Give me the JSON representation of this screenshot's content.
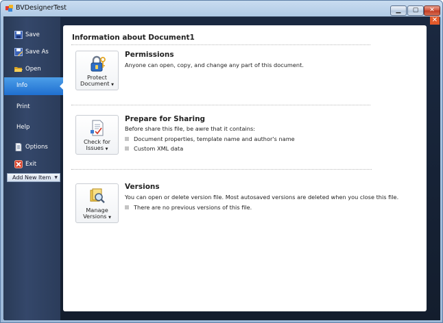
{
  "window": {
    "title": "BVDesignerTest",
    "min_glyph": "▁",
    "max_glyph": "▢",
    "close_glyph": "✕",
    "panel_close_glyph": "✕"
  },
  "sidebar": {
    "items": [
      {
        "label": "Save",
        "icon": "save-icon"
      },
      {
        "label": "Save As",
        "icon": "save-as-icon"
      },
      {
        "label": "Open",
        "icon": "open-folder-icon"
      },
      {
        "label": "Info",
        "icon": "",
        "active": true
      },
      {
        "label": "Print",
        "icon": ""
      },
      {
        "label": "Help",
        "icon": ""
      },
      {
        "label": "Options",
        "icon": "options-icon"
      },
      {
        "label": "Exit",
        "icon": "exit-icon"
      }
    ],
    "add_item_label": "Add New Item",
    "add_item_arrow": "▼"
  },
  "main": {
    "title": "Information about Document1",
    "sections": [
      {
        "button": {
          "line1": "Protect",
          "line2": "Document",
          "icon": "lock-key-icon"
        },
        "title": "Permissions",
        "desc": "Anyone can open, copy, and change any part of this document.",
        "bullets": []
      },
      {
        "button": {
          "line1": "Check for",
          "line2": "Issues",
          "icon": "check-document-icon"
        },
        "title": "Prepare for Sharing",
        "desc": "Before share this file, be awre that it contains:",
        "bullets": [
          "Document properties, template name and author's name",
          "Custom XML data"
        ]
      },
      {
        "button": {
          "line1": "Manage",
          "line2": "Versions",
          "icon": "versions-magnifier-icon"
        },
        "title": "Versions",
        "desc": "You can open or delete version file. Most autosaved versions are deleted when you close this file.",
        "bullets": [
          "There are no previous versions of this file."
        ]
      }
    ],
    "dropdown_glyph": "▼"
  },
  "colors": {
    "active_nav": "#2a7fd9",
    "sidebar": "#2f4262",
    "client_bg": "#16243a"
  }
}
